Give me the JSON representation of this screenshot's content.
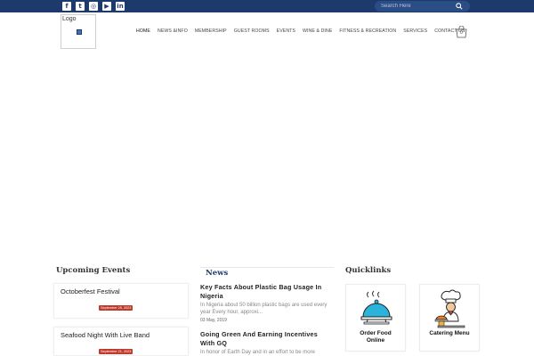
{
  "topbar": {
    "social": [
      {
        "icon": "facebook-icon",
        "glyph": "f"
      },
      {
        "icon": "twitter-icon",
        "glyph": "t"
      },
      {
        "icon": "instagram-icon",
        "glyph": "◎"
      },
      {
        "icon": "youtube-icon",
        "glyph": "▶"
      },
      {
        "icon": "linkedin-icon",
        "glyph": "in"
      }
    ],
    "search_placeholder": "Search Here"
  },
  "logo": {
    "text": "Logo"
  },
  "nav": {
    "items": [
      "Home",
      "News &Info",
      "Membership",
      "Guest Rooms",
      "Events",
      "Wine & Dine",
      "Fitness & Recreation",
      "Services",
      "Contact Us"
    ]
  },
  "cart": {
    "count": "0"
  },
  "events": {
    "title": "Upcoming Events",
    "items": [
      {
        "name": "Octoberfest Festival",
        "date": "September 25, 2023"
      },
      {
        "name": "Seafood Night With Live Band",
        "date": "September 21, 2023"
      }
    ]
  },
  "news": {
    "title": "News",
    "items": [
      {
        "headline": "Key Facts About Plastic Bag Usage In Nigeria",
        "excerpt": "In Nigeria about 50 billion plastic bags are used every year Every hour, approxi...",
        "date": "03 May, 2019"
      },
      {
        "headline": "Going Green And Earning Incentives With GQ",
        "excerpt": "In honor of Earth Day and in an effort to be more",
        "date": ""
      }
    ]
  },
  "quicklinks": {
    "title": "Quicklinks",
    "items": [
      {
        "label_line1": "Order Food",
        "label_line2": "Online",
        "icon": "food-cloche-icon"
      },
      {
        "label_line1": "Catering Menu",
        "label_line2": "",
        "icon": "chef-icon"
      }
    ]
  },
  "colors": {
    "topbar": "#1c3a6b",
    "accent_red": "#c0392b",
    "food_icon": "#2bb3d9"
  }
}
